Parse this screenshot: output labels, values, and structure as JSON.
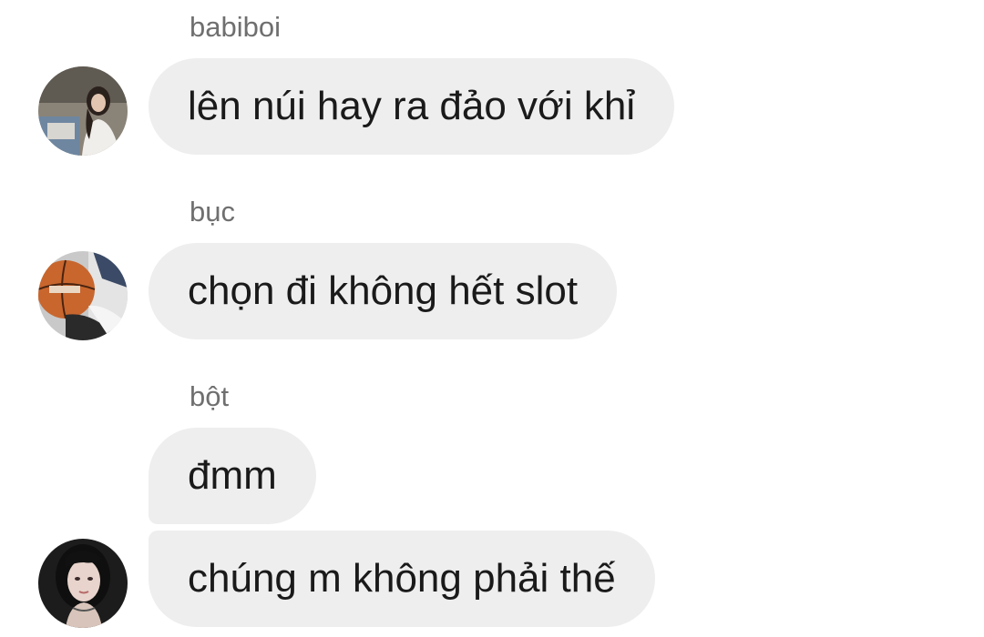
{
  "messages": [
    {
      "sender": "babiboi",
      "bubbles": [
        "lên núi hay ra đảo với khỉ"
      ],
      "avatar": "girl-photo-avatar"
    },
    {
      "sender": "bục",
      "bubbles": [
        "chọn đi không hết slot"
      ],
      "avatar": "basketball-photo-avatar"
    },
    {
      "sender": "bột",
      "bubbles": [
        "đmm",
        "chúng m không phải thế"
      ],
      "avatar": "girl-dark-hair-avatar"
    }
  ],
  "colors": {
    "bubble_background": "#eeeeee",
    "sender_text": "#6f6f6f",
    "message_text": "#1a1a1a"
  }
}
